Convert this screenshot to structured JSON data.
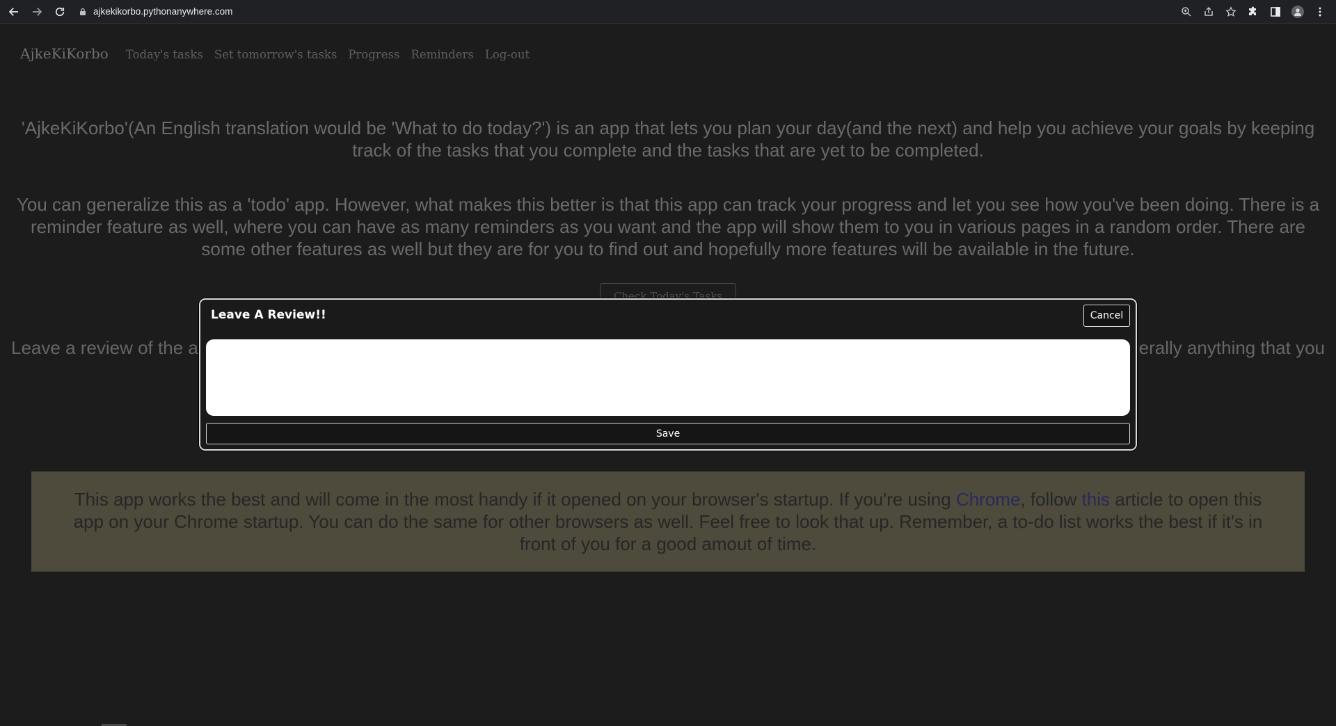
{
  "browser": {
    "url": "ajkekikorbo.pythonanywhere.com"
  },
  "nav": {
    "brand": "AjkeKiKorbo",
    "links": [
      "Today's tasks",
      "Set tomorrow's tasks",
      "Progress",
      "Reminders",
      "Log-out"
    ]
  },
  "content": {
    "intro": "'AjkeKiKorbo'(An English translation would be 'What to do today?') is an app that lets you plan your day(and the next) and help you achieve your goals by keeping track of the tasks that you complete and the tasks that are yet to be completed.",
    "description": "You can generalize this as a 'todo' app. However, what makes this better is that this app can track your progress and let you see how you've been doing. There is a reminder feature as well, where you can have as many reminders as you want and the app will show them to you in various pages in a random order. There are some other features as well but they are for you to find out and hopefully more features will be available in the future.",
    "check_button": "Check Today's Tasks",
    "review_prompt_start": "Leave a review of the ap",
    "review_prompt_end": "erally anything that you"
  },
  "notice": {
    "part1": "This app works the best and will come in the most handy if it opened on your browser's startup. If you're using ",
    "link_chrome": "Chrome",
    "part2": ", follow ",
    "link_this": "this",
    "part3": " article to open this app on your Chrome startup. You can do the same for other browsers as well. Feel free to look that up. Remember, a to-do list works the best if it's in front of you for a good amout of time."
  },
  "modal": {
    "title": "Leave A Review!!",
    "cancel_label": "Cancel",
    "input_value": "",
    "save_label": "Save"
  }
}
